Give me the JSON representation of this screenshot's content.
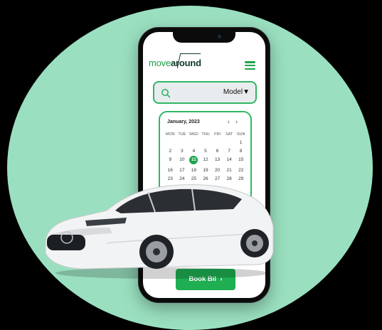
{
  "brand": {
    "part1": "move",
    "part2": "around"
  },
  "search": {
    "filter_label": "Model",
    "filter_caret": "▼"
  },
  "calendar": {
    "month": "January, 2023",
    "prev": "‹",
    "next": "›",
    "weekdays": [
      "MON",
      "TUE",
      "WED",
      "THU",
      "FRI",
      "SAT",
      "SUN"
    ],
    "days": [
      "",
      "",
      "",
      "",
      "",
      "",
      "1",
      "2",
      "3",
      "4",
      "5",
      "6",
      "7",
      "8",
      "9",
      "10",
      "11",
      "12",
      "13",
      "14",
      "15",
      "16",
      "17",
      "18",
      "19",
      "20",
      "21",
      "22",
      "23",
      "24",
      "25",
      "26",
      "27",
      "28",
      "29"
    ],
    "selected_day": "11"
  },
  "cta": {
    "label": "Book Bil",
    "arrow": "›"
  },
  "colors": {
    "accent": "#1ea34c",
    "circle": "#9ae0c0",
    "dark": "#0c3a24"
  },
  "icons": [
    "search-icon",
    "hamburger-menu-icon",
    "chevron-left-icon",
    "chevron-right-icon",
    "car-image"
  ]
}
